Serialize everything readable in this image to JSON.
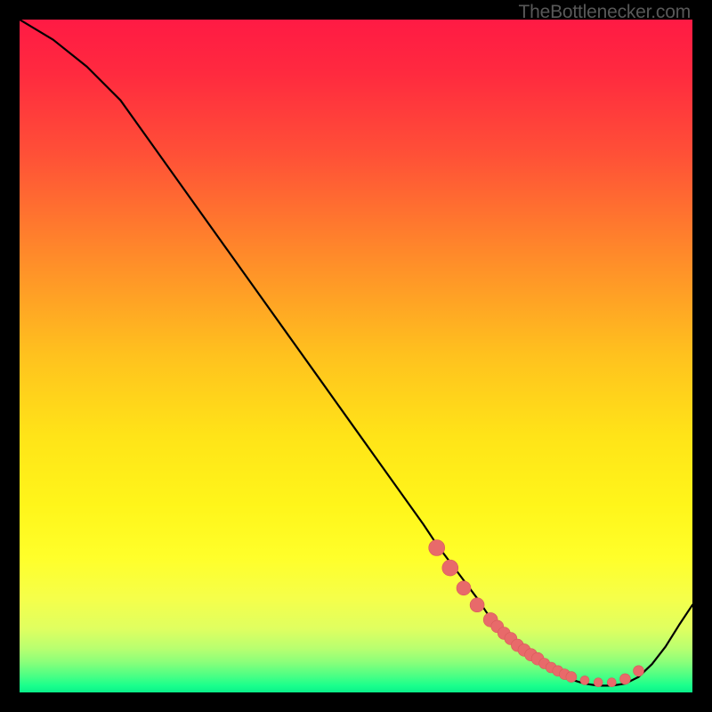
{
  "watermark": "TheBottlenecker.com",
  "colors": {
    "gradient_stops": [
      {
        "offset": 0.0,
        "color": "#ff1a44"
      },
      {
        "offset": 0.08,
        "color": "#ff2a3f"
      },
      {
        "offset": 0.2,
        "color": "#ff5037"
      },
      {
        "offset": 0.35,
        "color": "#ff8a2a"
      },
      {
        "offset": 0.5,
        "color": "#ffc21e"
      },
      {
        "offset": 0.62,
        "color": "#ffe418"
      },
      {
        "offset": 0.72,
        "color": "#fff51a"
      },
      {
        "offset": 0.8,
        "color": "#ffff2a"
      },
      {
        "offset": 0.86,
        "color": "#f5ff4a"
      },
      {
        "offset": 0.905,
        "color": "#e0ff60"
      },
      {
        "offset": 0.935,
        "color": "#b8ff70"
      },
      {
        "offset": 0.955,
        "color": "#8aff7a"
      },
      {
        "offset": 0.975,
        "color": "#4cff84"
      },
      {
        "offset": 0.99,
        "color": "#1aff8c"
      },
      {
        "offset": 1.0,
        "color": "#0af08a"
      }
    ],
    "curve": "#000000",
    "marker_fill": "#e86a6a",
    "marker_stroke": "#d85a5a"
  },
  "chart_data": {
    "type": "line",
    "title": "",
    "xlabel": "",
    "ylabel": "",
    "xlim": [
      0,
      100
    ],
    "ylim": [
      0,
      100
    ],
    "x": [
      0,
      5,
      10,
      15,
      20,
      25,
      30,
      35,
      40,
      45,
      50,
      55,
      60,
      62,
      65,
      68,
      70,
      72,
      74,
      76,
      78,
      80,
      82,
      84,
      86,
      88,
      90,
      92,
      94,
      96,
      98,
      100
    ],
    "y": [
      100,
      97,
      93,
      88,
      81,
      74,
      67,
      60,
      53,
      46,
      39,
      32,
      25,
      22,
      18,
      14,
      11,
      9,
      7,
      5.5,
      4,
      2.8,
      1.9,
      1.3,
      1.0,
      1.0,
      1.3,
      2.3,
      4.2,
      6.8,
      10.0,
      13.0
    ],
    "markers_x": [
      62,
      64,
      66,
      68,
      70,
      71,
      72,
      73,
      74,
      75,
      76,
      77,
      78,
      79,
      80,
      81,
      82,
      84,
      86,
      88,
      90,
      92
    ],
    "markers_y": [
      21.5,
      18.5,
      15.5,
      13.0,
      10.8,
      9.8,
      8.8,
      8.0,
      7.0,
      6.3,
      5.6,
      5.0,
      4.3,
      3.7,
      3.2,
      2.7,
      2.3,
      1.8,
      1.5,
      1.5,
      2.0,
      3.2
    ],
    "marker_sizes": [
      9,
      9,
      8,
      8,
      8,
      7,
      7,
      7,
      7,
      7,
      7,
      7,
      6,
      6,
      6,
      6,
      6,
      5,
      5,
      5,
      6,
      6
    ]
  }
}
